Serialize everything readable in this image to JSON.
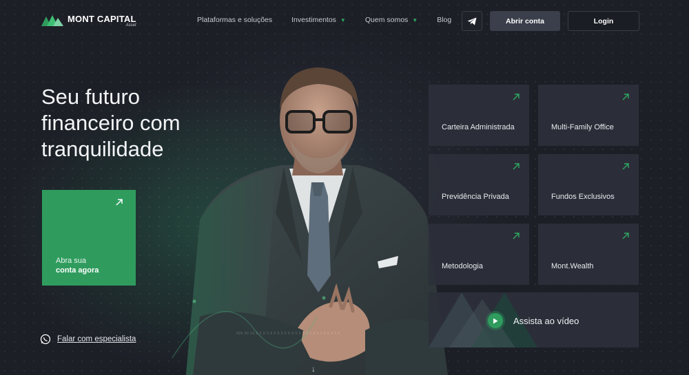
{
  "brand": {
    "name": "MONT CAPITAL",
    "sub": "Asset"
  },
  "nav": {
    "items": [
      {
        "label": "Plataformas e soluções",
        "dropdown": false
      },
      {
        "label": "Investimentos",
        "dropdown": true
      },
      {
        "label": "Quem somos",
        "dropdown": true
      },
      {
        "label": "Blog",
        "dropdown": false
      }
    ],
    "open_account": "Abrir conta",
    "login": "Login"
  },
  "hero": {
    "headline_lines": [
      "Seu futuro",
      "financeiro com",
      "tranquilidade"
    ],
    "cta_line1": "Abra sua",
    "cta_line2": "conta agora",
    "specialist_label": "Falar com especialista"
  },
  "tiles": [
    {
      "label": "Carteira Administrada"
    },
    {
      "label": "Multi-Family Office"
    },
    {
      "label": "Previdência Privada"
    },
    {
      "label": "Fundos Exclusivos"
    },
    {
      "label": "Metodologia"
    },
    {
      "label": "Mont.Wealth"
    }
  ],
  "video": {
    "label": "Assista ao vídeo"
  },
  "ticker_text": "426.00 15 0.5 5 0.6 5 5 5 5 5 0 0 5 5 5   5 8 5 5 5 5   5 5 5",
  "colors": {
    "accent": "#2f9c5e",
    "background": "#1d1f27",
    "tile": "#2d3039",
    "button": "#3a3f4b"
  },
  "icons": [
    "logo-mark",
    "chevron-down-icon",
    "telegram-icon",
    "arrow-up-right-icon",
    "whatsapp-icon",
    "play-icon",
    "arrow-down-icon"
  ]
}
